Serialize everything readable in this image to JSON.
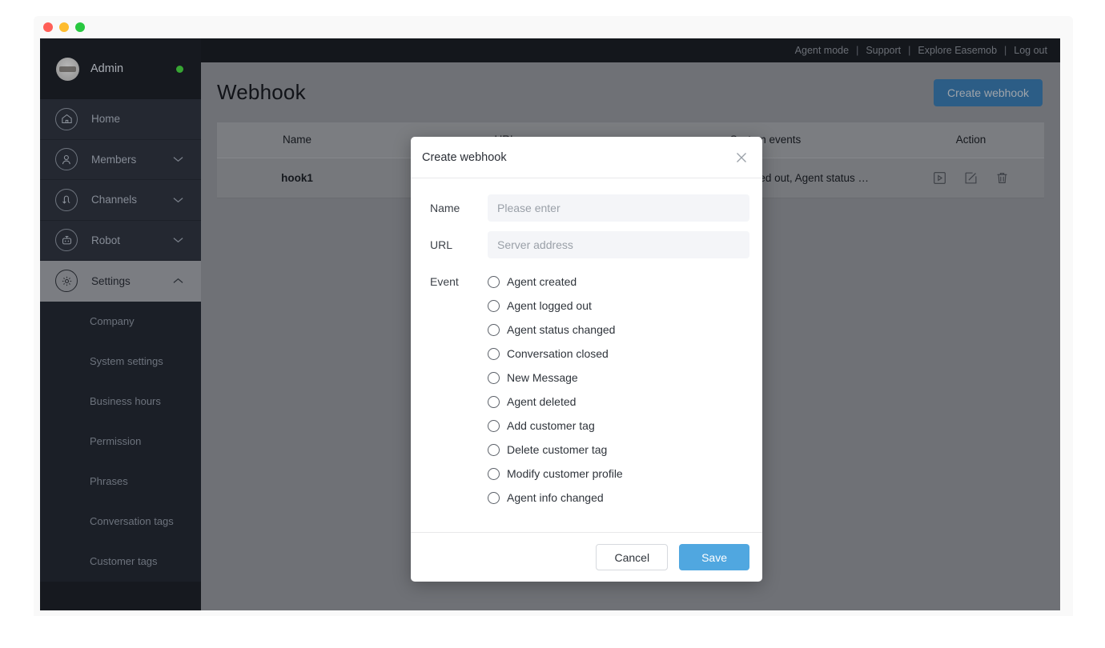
{
  "window": {
    "traffic_lights": [
      "close",
      "minimize",
      "maximize"
    ]
  },
  "sidebar": {
    "profile": {
      "name": "Admin",
      "status": "online"
    },
    "items": [
      {
        "label": "Home",
        "icon": "home-icon",
        "expandable": false,
        "active": false
      },
      {
        "label": "Members",
        "icon": "members-icon",
        "expandable": true,
        "active": false,
        "chevron": "down"
      },
      {
        "label": "Channels",
        "icon": "channels-icon",
        "expandable": true,
        "active": false,
        "chevron": "down"
      },
      {
        "label": "Robot",
        "icon": "robot-icon",
        "expandable": true,
        "active": false,
        "chevron": "down"
      },
      {
        "label": "Settings",
        "icon": "gear-icon",
        "expandable": true,
        "active": true,
        "chevron": "up"
      }
    ],
    "submenu": [
      {
        "label": "Company"
      },
      {
        "label": "System settings"
      },
      {
        "label": "Business hours"
      },
      {
        "label": "Permission"
      },
      {
        "label": "Phrases"
      },
      {
        "label": "Conversation tags"
      },
      {
        "label": "Customer tags"
      }
    ]
  },
  "topbar": {
    "links": [
      "Agent mode",
      "Support",
      "Explore Easemob",
      "Log out"
    ],
    "separator": "|"
  },
  "page": {
    "title": "Webhook",
    "create_button": "Create webhook"
  },
  "table": {
    "columns": [
      "Name",
      "URL",
      "System events",
      "Action"
    ],
    "rows": [
      {
        "name": "hook1",
        "url": "",
        "events": "Agent created, Agent logged out, Agent status …",
        "actions": [
          "run-icon",
          "edit-icon",
          "delete-icon"
        ]
      }
    ]
  },
  "modal": {
    "title": "Create webhook",
    "close_icon": "close-icon",
    "fields": [
      {
        "label": "Name",
        "value": "",
        "placeholder": "Please enter"
      },
      {
        "label": "URL",
        "value": "",
        "placeholder": "Server address"
      }
    ],
    "event_label": "Event",
    "events": [
      {
        "label": "Agent created",
        "selected": false
      },
      {
        "label": "Agent logged out",
        "selected": false
      },
      {
        "label": "Agent status changed",
        "selected": false
      },
      {
        "label": "Conversation closed",
        "selected": false
      },
      {
        "label": "New Message",
        "selected": false
      },
      {
        "label": "Agent deleted",
        "selected": false
      },
      {
        "label": "Add customer tag",
        "selected": false
      },
      {
        "label": "Delete customer tag",
        "selected": false
      },
      {
        "label": "Modify customer profile",
        "selected": false
      },
      {
        "label": "Agent info changed",
        "selected": false
      }
    ],
    "cancel_label": "Cancel",
    "save_label": "Save"
  },
  "colors": {
    "sidebar_bg": "#16191f",
    "nav_bg": "#242831",
    "nav_active_bg": "#7b7d82",
    "overlay_dim": "#6f7176",
    "accent_blue": "#50a7e0",
    "primary_button": "#2c5d86",
    "status_online": "#37a533"
  }
}
